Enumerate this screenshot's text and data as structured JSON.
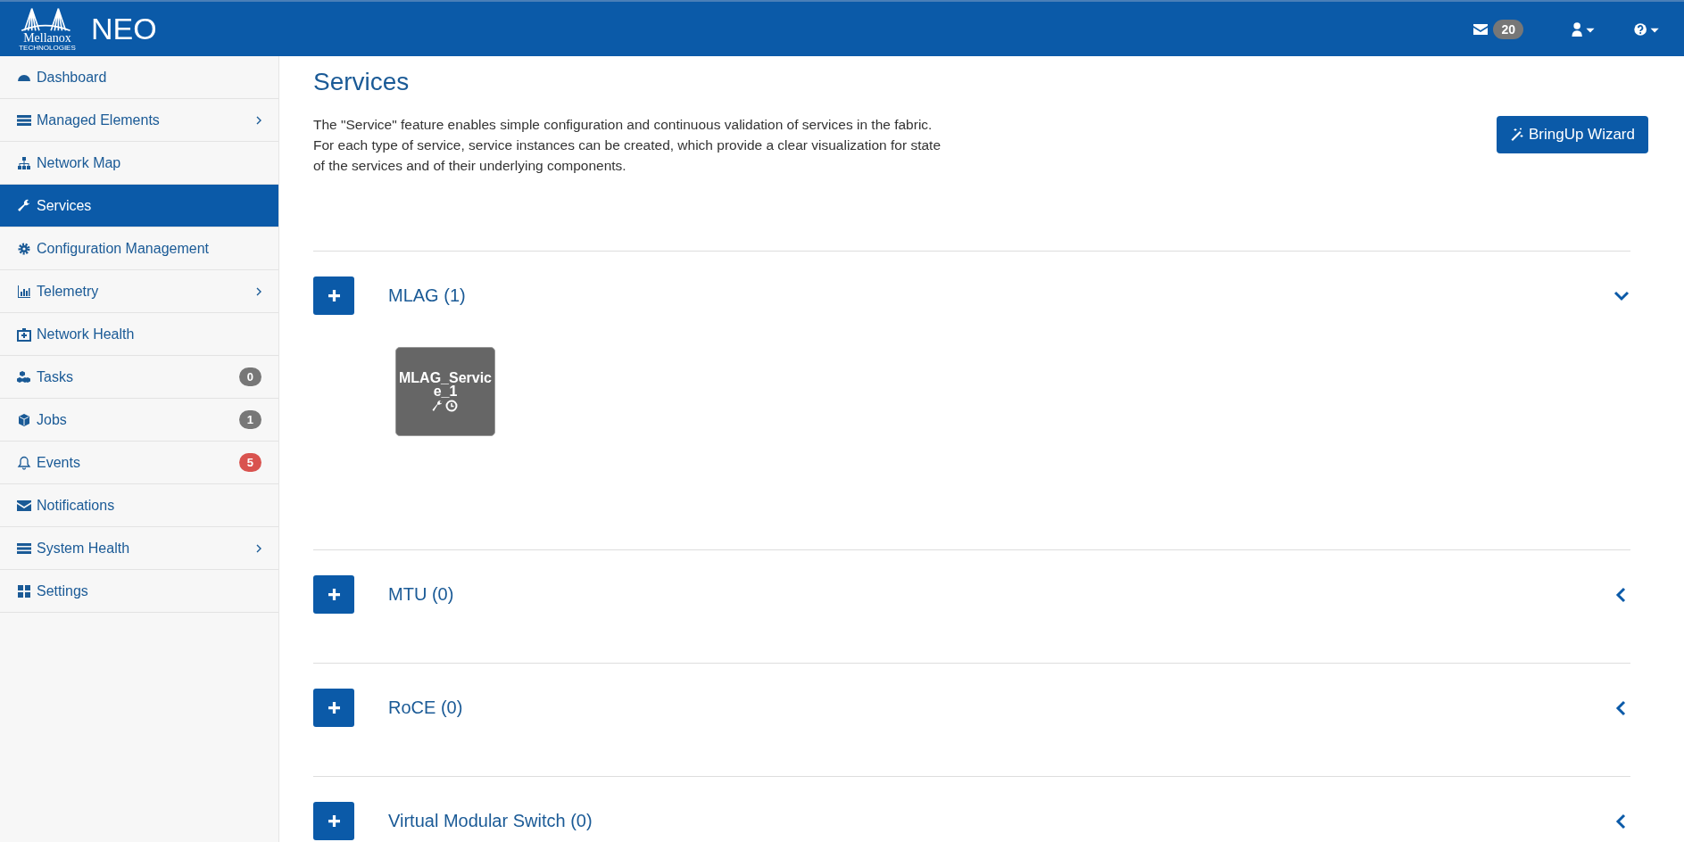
{
  "header": {
    "logo_text": "Mellanox",
    "logo_subtext": "TECHNOLOGIES",
    "app_name": "NEO",
    "messages_count": "20"
  },
  "sidebar": {
    "items": [
      {
        "label": "Dashboard",
        "selected": false,
        "submenu": false
      },
      {
        "label": "Managed Elements",
        "selected": false,
        "submenu": true
      },
      {
        "label": "Network Map",
        "selected": false,
        "submenu": false
      },
      {
        "label": "Services",
        "selected": true,
        "submenu": false
      },
      {
        "label": "Configuration Management",
        "selected": false,
        "submenu": false
      },
      {
        "label": "Telemetry",
        "selected": false,
        "submenu": true
      },
      {
        "label": "Network Health",
        "selected": false,
        "submenu": false
      },
      {
        "label": "Tasks",
        "selected": false,
        "submenu": false,
        "badge": "0",
        "color": "#777777"
      },
      {
        "label": "Jobs",
        "selected": false,
        "submenu": false,
        "badge": "1",
        "color": "#777777"
      },
      {
        "label": "Events",
        "selected": false,
        "submenu": false,
        "badge": "5",
        "color": "#d9534f"
      },
      {
        "label": "Notifications",
        "selected": false,
        "submenu": false
      },
      {
        "label": "System Health",
        "selected": false,
        "submenu": true
      },
      {
        "label": "Settings",
        "selected": false,
        "submenu": false
      }
    ]
  },
  "page": {
    "title": "Services",
    "description": "The \"Service\" feature enables simple configuration and continuous validation of services in the fabric. For each type of service, service instances can be created, which provide a clear visualization for state of the services and of their underlying components.",
    "wizard_button": "BringUp Wizard"
  },
  "sections": [
    {
      "title": "MLAG (1)",
      "expanded": true,
      "instances": [
        {
          "name": "MLAG_Service_1"
        }
      ]
    },
    {
      "title": "MTU (0)",
      "expanded": false
    },
    {
      "title": "RoCE (0)",
      "expanded": false
    },
    {
      "title": "Virtual Modular Switch (0)",
      "expanded": false
    }
  ]
}
